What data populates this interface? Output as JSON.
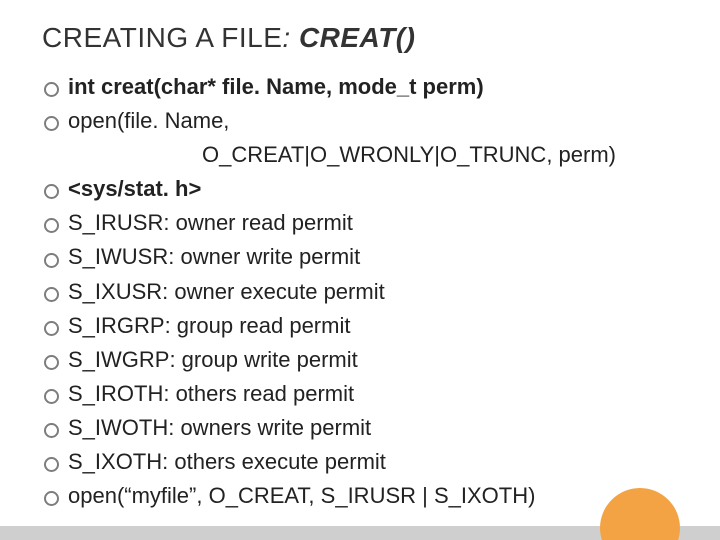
{
  "title": {
    "prefix": "CREATING A FILE",
    "colon": ": ",
    "func": "CREAT()"
  },
  "items": [
    {
      "text": "int creat(char* file. Name, mode_t perm)",
      "bold": true
    },
    {
      "text": "open(file. Name,"
    },
    {
      "text": "O_CREAT|O_WRONLY|O_TRUNC, perm)",
      "indent": true,
      "nobullet": true
    },
    {
      "text": "<sys/stat. h>",
      "bold": true
    },
    {
      "text": "S_IRUSR: owner read permit"
    },
    {
      "text": "S_IWUSR: owner write permit"
    },
    {
      "text": "S_IXUSR: owner execute permit"
    },
    {
      "text": "S_IRGRP: group read permit"
    },
    {
      "text": "S_IWGRP: group write permit"
    },
    {
      "text": "S_IROTH: others read permit"
    },
    {
      "text": "S_IWOTH: owners write permit"
    },
    {
      "text": "S_IXOTH: others execute permit"
    },
    {
      "text": "open(“myfile”, O_CREAT, S_IRUSR | S_IXOTH)"
    }
  ]
}
